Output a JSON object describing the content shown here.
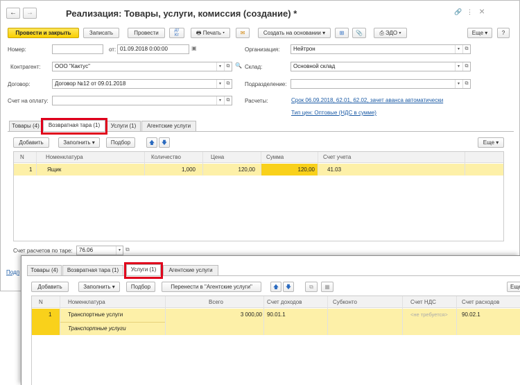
{
  "window1": {
    "title": "Реализация: Товары, услуги, комиссия (создание) *",
    "nav_back": "←",
    "nav_forward": "→",
    "star": "☆",
    "link_icon": "🔗",
    "more_icon": "⋮",
    "close_icon": "×",
    "toolbar": {
      "post_close": "Провести и закрыть",
      "save": "Записать",
      "post": "Провести",
      "print": "Печать",
      "create_based": "Создать на основании",
      "edo": "ЭДО",
      "more": "Еще",
      "help": "?"
    },
    "form": {
      "number_label": "Номер:",
      "number_value": "",
      "date_from_label": "от:",
      "date_value": "01.09.2018  0:00:00",
      "org_label": "Организация:",
      "org_value": "Нейтрон",
      "contractor_label": "Контрагент:",
      "contractor_value": "ООО \"Кактус\"",
      "warehouse_label": "Склад:",
      "warehouse_value": "Основной склад",
      "contract_label": "Договор:",
      "contract_value": "Договор №12 от 09.01.2018",
      "dept_label": "Подразделение:",
      "dept_value": "",
      "invoice_label": "Счет на оплату:",
      "invoice_value": "",
      "settlements_label": "Расчеты:",
      "settlements_link": "Срок 06.09.2018, 62.01, 62.02, зачет аванса автоматически",
      "price_link": "Тип цен: Оптовые (НДС в сумме)"
    },
    "tabs": [
      "Товары (4)",
      "Возвратная тара (1)",
      "Услуги (1)",
      "Агентские услуги"
    ],
    "table_toolbar": {
      "add": "Добавить",
      "fill": "Заполнить",
      "select": "Подбор",
      "more": "Еще"
    },
    "columns": [
      "N",
      "Номенклатура",
      "Количество",
      "Цена",
      "Сумма",
      "Счет учета"
    ],
    "rows": [
      {
        "n": "1",
        "item": "Ящик",
        "qty": "1,000",
        "price": "120,00",
        "sum": "120,00",
        "account": "41.03"
      }
    ],
    "tare_label": "Счет расчетов по таре:",
    "tare_value": "76.06",
    "bottom_link": "Подп"
  },
  "window2": {
    "tabs": [
      "Товары (4)",
      "Возвратная тара (1)",
      "Услуги (1)",
      "Агентские услуги"
    ],
    "table_toolbar": {
      "add": "Добавить",
      "fill": "Заполнить",
      "select": "Подбор",
      "transfer": "Перенести в \"Агентские услуги\"",
      "more": "Еще"
    },
    "columns": [
      "N",
      "Номенклатура",
      "Всего",
      "Счет доходов",
      "Субконто",
      "Счет НДС",
      "Счет расходов"
    ],
    "rows": [
      {
        "n": "1",
        "item": "Транспортные услуги",
        "item_content": "Транспортные услуги",
        "total": "3 000,00",
        "income": "90.01.1",
        "subconto": "",
        "vat": "<не требуется>",
        "expense": "90.02.1"
      }
    ]
  }
}
